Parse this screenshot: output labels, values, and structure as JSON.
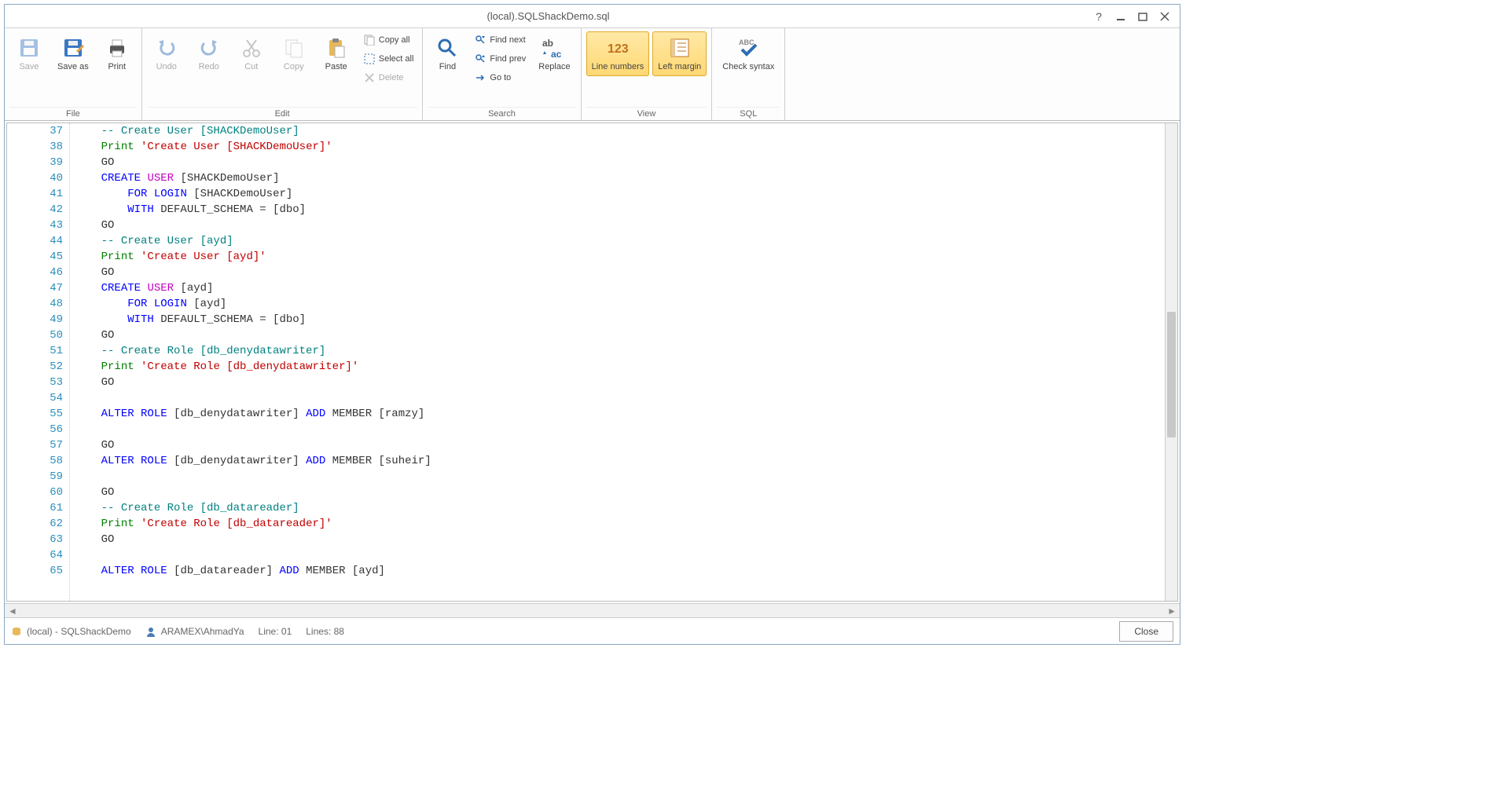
{
  "title": "(local).SQLShackDemo.sql",
  "ribbon": {
    "groups": {
      "file": {
        "label": "File",
        "save": "Save",
        "save_as": "Save as",
        "print": "Print"
      },
      "edit": {
        "label": "Edit",
        "undo": "Undo",
        "redo": "Redo",
        "cut": "Cut",
        "copy": "Copy",
        "paste": "Paste",
        "copy_all": "Copy all",
        "select_all": "Select all",
        "delete": "Delete"
      },
      "search": {
        "label": "Search",
        "find": "Find",
        "find_next": "Find next",
        "find_prev": "Find prev",
        "goto": "Go to",
        "replace": "Replace"
      },
      "view": {
        "label": "View",
        "line_numbers": "Line\nnumbers",
        "left_margin": "Left\nmargin"
      },
      "sql": {
        "label": "SQL",
        "check_syntax": "Check\nsyntax"
      }
    }
  },
  "code_lines": [
    {
      "n": 37,
      "tokens": [
        [
          "    ",
          ""
        ],
        [
          "-- Create User [SHACKDemoUser]",
          "kw-teal"
        ]
      ]
    },
    {
      "n": 38,
      "tokens": [
        [
          "    ",
          ""
        ],
        [
          "Print",
          "kw-green"
        ],
        [
          " ",
          ""
        ],
        [
          "'Create User [SHACKDemoUser]'",
          "kw-red"
        ]
      ]
    },
    {
      "n": 39,
      "tokens": [
        [
          "    ",
          ""
        ],
        [
          "GO",
          ""
        ]
      ]
    },
    {
      "n": 40,
      "tokens": [
        [
          "    ",
          ""
        ],
        [
          "CREATE",
          "kw-blue"
        ],
        [
          " ",
          ""
        ],
        [
          "USER",
          "kw-mag"
        ],
        [
          " [SHACKDemoUser]",
          ""
        ]
      ]
    },
    {
      "n": 41,
      "tokens": [
        [
          "        ",
          ""
        ],
        [
          "FOR",
          "kw-blue"
        ],
        [
          " ",
          ""
        ],
        [
          "LOGIN",
          "kw-blue"
        ],
        [
          " [SHACKDemoUser]",
          ""
        ]
      ]
    },
    {
      "n": 42,
      "tokens": [
        [
          "        ",
          ""
        ],
        [
          "WITH",
          "kw-blue"
        ],
        [
          " DEFAULT_SCHEMA = [dbo]",
          ""
        ]
      ]
    },
    {
      "n": 43,
      "tokens": [
        [
          "    ",
          ""
        ],
        [
          "GO",
          ""
        ]
      ]
    },
    {
      "n": 44,
      "tokens": [
        [
          "    ",
          ""
        ],
        [
          "-- Create User [ayd]",
          "kw-teal"
        ]
      ]
    },
    {
      "n": 45,
      "tokens": [
        [
          "    ",
          ""
        ],
        [
          "Print",
          "kw-green"
        ],
        [
          " ",
          ""
        ],
        [
          "'Create User [ayd]'",
          "kw-red"
        ]
      ]
    },
    {
      "n": 46,
      "tokens": [
        [
          "    ",
          ""
        ],
        [
          "GO",
          ""
        ]
      ]
    },
    {
      "n": 47,
      "tokens": [
        [
          "    ",
          ""
        ],
        [
          "CREATE",
          "kw-blue"
        ],
        [
          " ",
          ""
        ],
        [
          "USER",
          "kw-mag"
        ],
        [
          " [ayd]",
          ""
        ]
      ]
    },
    {
      "n": 48,
      "tokens": [
        [
          "        ",
          ""
        ],
        [
          "FOR",
          "kw-blue"
        ],
        [
          " ",
          ""
        ],
        [
          "LOGIN",
          "kw-blue"
        ],
        [
          " [ayd]",
          ""
        ]
      ]
    },
    {
      "n": 49,
      "tokens": [
        [
          "        ",
          ""
        ],
        [
          "WITH",
          "kw-blue"
        ],
        [
          " DEFAULT_SCHEMA = [dbo]",
          ""
        ]
      ]
    },
    {
      "n": 50,
      "tokens": [
        [
          "    ",
          ""
        ],
        [
          "GO",
          ""
        ]
      ]
    },
    {
      "n": 51,
      "tokens": [
        [
          "    ",
          ""
        ],
        [
          "-- Create Role [db_denydatawriter]",
          "kw-teal"
        ]
      ]
    },
    {
      "n": 52,
      "tokens": [
        [
          "    ",
          ""
        ],
        [
          "Print",
          "kw-green"
        ],
        [
          " ",
          ""
        ],
        [
          "'Create Role [db_denydatawriter]'",
          "kw-red"
        ]
      ]
    },
    {
      "n": 53,
      "tokens": [
        [
          "    ",
          ""
        ],
        [
          "GO",
          ""
        ]
      ]
    },
    {
      "n": 54,
      "tokens": []
    },
    {
      "n": 55,
      "tokens": [
        [
          "    ",
          ""
        ],
        [
          "ALTER",
          "kw-blue"
        ],
        [
          " ",
          ""
        ],
        [
          "ROLE",
          "kw-blue"
        ],
        [
          " [db_denydatawriter] ",
          ""
        ],
        [
          "ADD",
          "kw-blue"
        ],
        [
          " MEMBER [ramzy]",
          ""
        ]
      ]
    },
    {
      "n": 56,
      "tokens": []
    },
    {
      "n": 57,
      "tokens": [
        [
          "    ",
          ""
        ],
        [
          "GO",
          ""
        ]
      ]
    },
    {
      "n": 58,
      "tokens": [
        [
          "    ",
          ""
        ],
        [
          "ALTER",
          "kw-blue"
        ],
        [
          " ",
          ""
        ],
        [
          "ROLE",
          "kw-blue"
        ],
        [
          " [db_denydatawriter] ",
          ""
        ],
        [
          "ADD",
          "kw-blue"
        ],
        [
          " MEMBER [suheir]",
          ""
        ]
      ]
    },
    {
      "n": 59,
      "tokens": []
    },
    {
      "n": 60,
      "tokens": [
        [
          "    ",
          ""
        ],
        [
          "GO",
          ""
        ]
      ]
    },
    {
      "n": 61,
      "tokens": [
        [
          "    ",
          ""
        ],
        [
          "-- Create Role [db_datareader]",
          "kw-teal"
        ]
      ]
    },
    {
      "n": 62,
      "tokens": [
        [
          "    ",
          ""
        ],
        [
          "Print",
          "kw-green"
        ],
        [
          " ",
          ""
        ],
        [
          "'Create Role [db_datareader]'",
          "kw-red"
        ]
      ]
    },
    {
      "n": 63,
      "tokens": [
        [
          "    ",
          ""
        ],
        [
          "GO",
          ""
        ]
      ]
    },
    {
      "n": 64,
      "tokens": []
    },
    {
      "n": 65,
      "tokens": [
        [
          "    ",
          ""
        ],
        [
          "ALTER",
          "kw-blue"
        ],
        [
          " ",
          ""
        ],
        [
          "ROLE",
          "kw-blue"
        ],
        [
          " [db_datareader] ",
          ""
        ],
        [
          "ADD",
          "kw-blue"
        ],
        [
          " MEMBER [ayd]",
          ""
        ]
      ]
    }
  ],
  "status": {
    "connection": "(local) - SQLShackDemo",
    "user": "ARAMEX\\AhmadYa",
    "line": "Line: 01",
    "lines": "Lines: 88",
    "close": "Close"
  }
}
